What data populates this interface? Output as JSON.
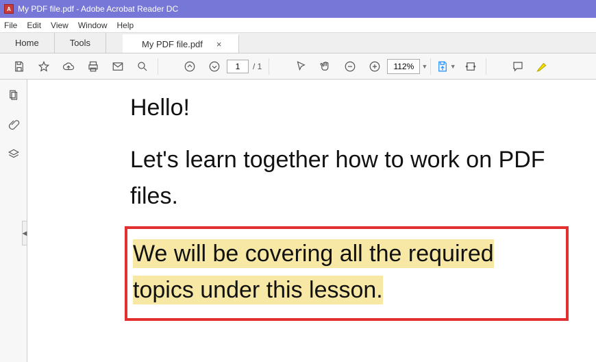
{
  "window": {
    "title": "My PDF file.pdf - Adobe Acrobat Reader DC"
  },
  "menubar": {
    "file": "File",
    "edit": "Edit",
    "view": "View",
    "window": "Window",
    "help": "Help"
  },
  "tabs": {
    "home": "Home",
    "tools": "Tools",
    "file": "My PDF file.pdf",
    "close": "×"
  },
  "toolbar": {
    "page_current": "1",
    "page_total": "/ 1",
    "zoom": "112%"
  },
  "document": {
    "line1": "Hello!",
    "line2": "Let's learn together how to work on PDF files.",
    "highlighted_a": "We will be covering all the required",
    "highlighted_b": "topics under this lesson."
  }
}
